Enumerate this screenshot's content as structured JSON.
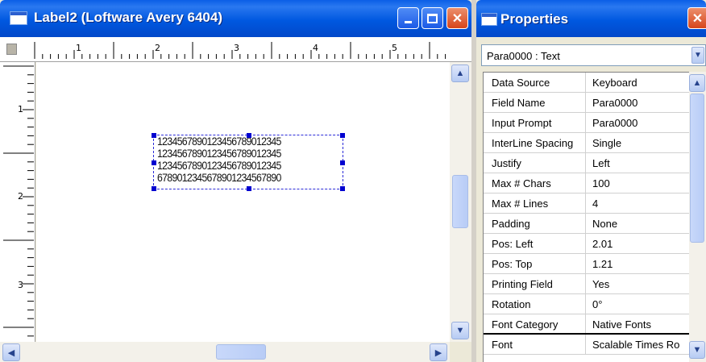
{
  "label_window": {
    "title": "Label2 (Loftware Avery 6404)",
    "ruler_h_numbers": [
      "1",
      "2",
      "3",
      "4",
      "5"
    ],
    "ruler_v_numbers": [
      "1",
      "2",
      "3"
    ],
    "text_lines": [
      "1234567890123456789012345",
      "1234567890123456789012345",
      "1234567890123456789012345",
      "6789012345678901234567890"
    ]
  },
  "properties_window": {
    "title": "Properties",
    "object_selector": "Para0000 : Text",
    "rows": [
      {
        "name": "Data Source",
        "value": "Keyboard"
      },
      {
        "name": "Field Name",
        "value": "Para0000"
      },
      {
        "name": "Input Prompt",
        "value": "Para0000"
      },
      {
        "name": "InterLine Spacing",
        "value": "Single"
      },
      {
        "name": "Justify",
        "value": "Left"
      },
      {
        "name": "Max # Chars",
        "value": "100"
      },
      {
        "name": "Max # Lines",
        "value": "4"
      },
      {
        "name": "Padding",
        "value": "None"
      },
      {
        "name": "Pos: Left",
        "value": "2.01"
      },
      {
        "name": "Pos: Top",
        "value": "1.21"
      },
      {
        "name": "Printing Field",
        "value": "Yes"
      },
      {
        "name": "Rotation",
        "value": "0°"
      },
      {
        "name": "Font Category",
        "value": "Native Fonts"
      },
      {
        "name": "Font",
        "value": "Scalable Times Ro"
      }
    ]
  },
  "colors": {
    "titlebar": "#0058e0",
    "selection_handles": "#0000d0",
    "window_bg": "#ece9d8"
  }
}
